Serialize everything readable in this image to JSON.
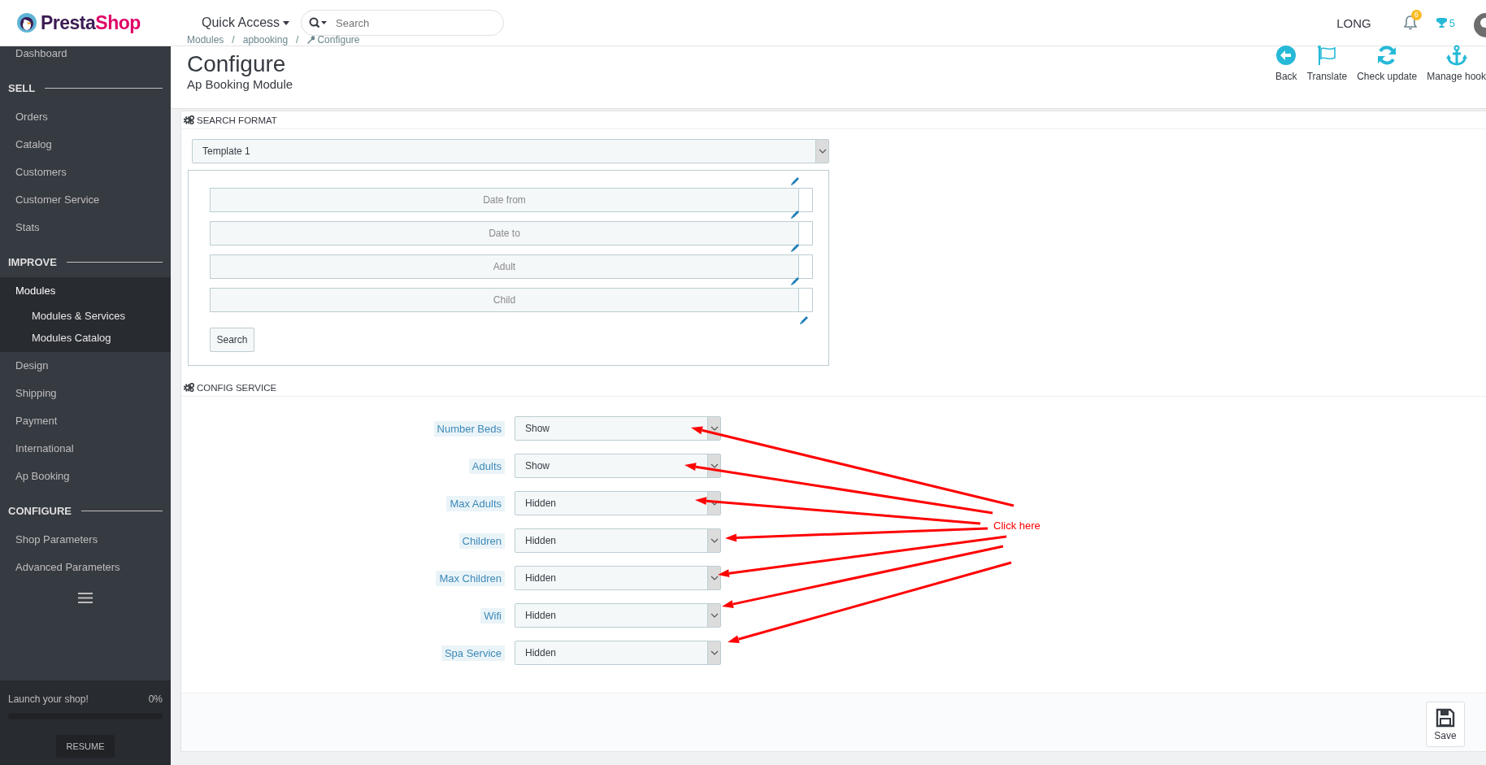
{
  "logo": {
    "parts": [
      "Presta",
      "Shop"
    ]
  },
  "topbar": {
    "quick_access": "Quick Access",
    "search": {
      "placeholder": "Search"
    },
    "user": "LONG",
    "notifications": "6",
    "trophies": "5"
  },
  "sidebar": {
    "items": [
      {
        "kind": "link",
        "label": "Dashboard",
        "selected": false
      },
      {
        "kind": "section",
        "label": "SELL"
      },
      {
        "kind": "link",
        "label": "Orders",
        "selected": false
      },
      {
        "kind": "link",
        "label": "Catalog",
        "selected": false
      },
      {
        "kind": "link",
        "label": "Customers",
        "selected": false
      },
      {
        "kind": "link",
        "label": "Customer Service",
        "selected": false
      },
      {
        "kind": "link",
        "label": "Stats",
        "selected": false
      },
      {
        "kind": "section",
        "label": "IMPROVE"
      },
      {
        "kind": "link",
        "label": "Modules",
        "selected": true,
        "children": [
          {
            "label": "Modules & Services",
            "selected": false
          },
          {
            "label": "Modules Catalog",
            "selected": false
          }
        ]
      },
      {
        "kind": "link",
        "label": "Design",
        "selected": false
      },
      {
        "kind": "link",
        "label": "Shipping",
        "selected": false
      },
      {
        "kind": "link",
        "label": "Payment",
        "selected": false
      },
      {
        "kind": "link",
        "label": "International",
        "selected": false
      },
      {
        "kind": "link",
        "label": "Ap Booking",
        "selected": false
      },
      {
        "kind": "section",
        "label": "CONFIGURE"
      },
      {
        "kind": "link",
        "label": "Shop Parameters",
        "selected": false
      },
      {
        "kind": "link",
        "label": "Advanced Parameters",
        "selected": false
      }
    ],
    "launch": {
      "label": "Launch your shop!",
      "percent": "0%",
      "level": 0,
      "button": "RESUME"
    }
  },
  "header": {
    "breadcrumb": [
      {
        "label": "Modules",
        "separator": "/"
      },
      {
        "label": "apbooking",
        "separator": "/"
      },
      {
        "label": "Configure"
      }
    ],
    "title": "Configure",
    "subtitle": "Ap Booking Module",
    "toolbar": [
      {
        "kind": "back",
        "label": "Back"
      },
      {
        "kind": "translate",
        "label": "Translate"
      },
      {
        "kind": "update",
        "label": "Check update"
      },
      {
        "kind": "hook",
        "label": "Manage hook"
      }
    ]
  },
  "search_format": {
    "title": "SEARCH FORMAT",
    "template": "Template 1",
    "fields": [
      {
        "placeholder": "Date from"
      },
      {
        "placeholder": "Date to"
      },
      {
        "placeholder": "Adult"
      },
      {
        "placeholder": "Child"
      }
    ],
    "button": "Search"
  },
  "config_service": {
    "title": "CONFIG SERVICE",
    "rows": [
      {
        "label": "Number Beds",
        "value": "Show"
      },
      {
        "label": "Adults",
        "value": "Show"
      },
      {
        "label": "Max Adults",
        "value": "Hidden"
      },
      {
        "label": "Children",
        "value": "Hidden"
      },
      {
        "label": "Max Children",
        "value": "Hidden"
      },
      {
        "label": "Wifi",
        "value": "Hidden"
      },
      {
        "label": "Spa Service",
        "value": "Hidden"
      }
    ]
  },
  "annotation": {
    "text": "Click here"
  },
  "footer": {
    "save": "Save"
  }
}
